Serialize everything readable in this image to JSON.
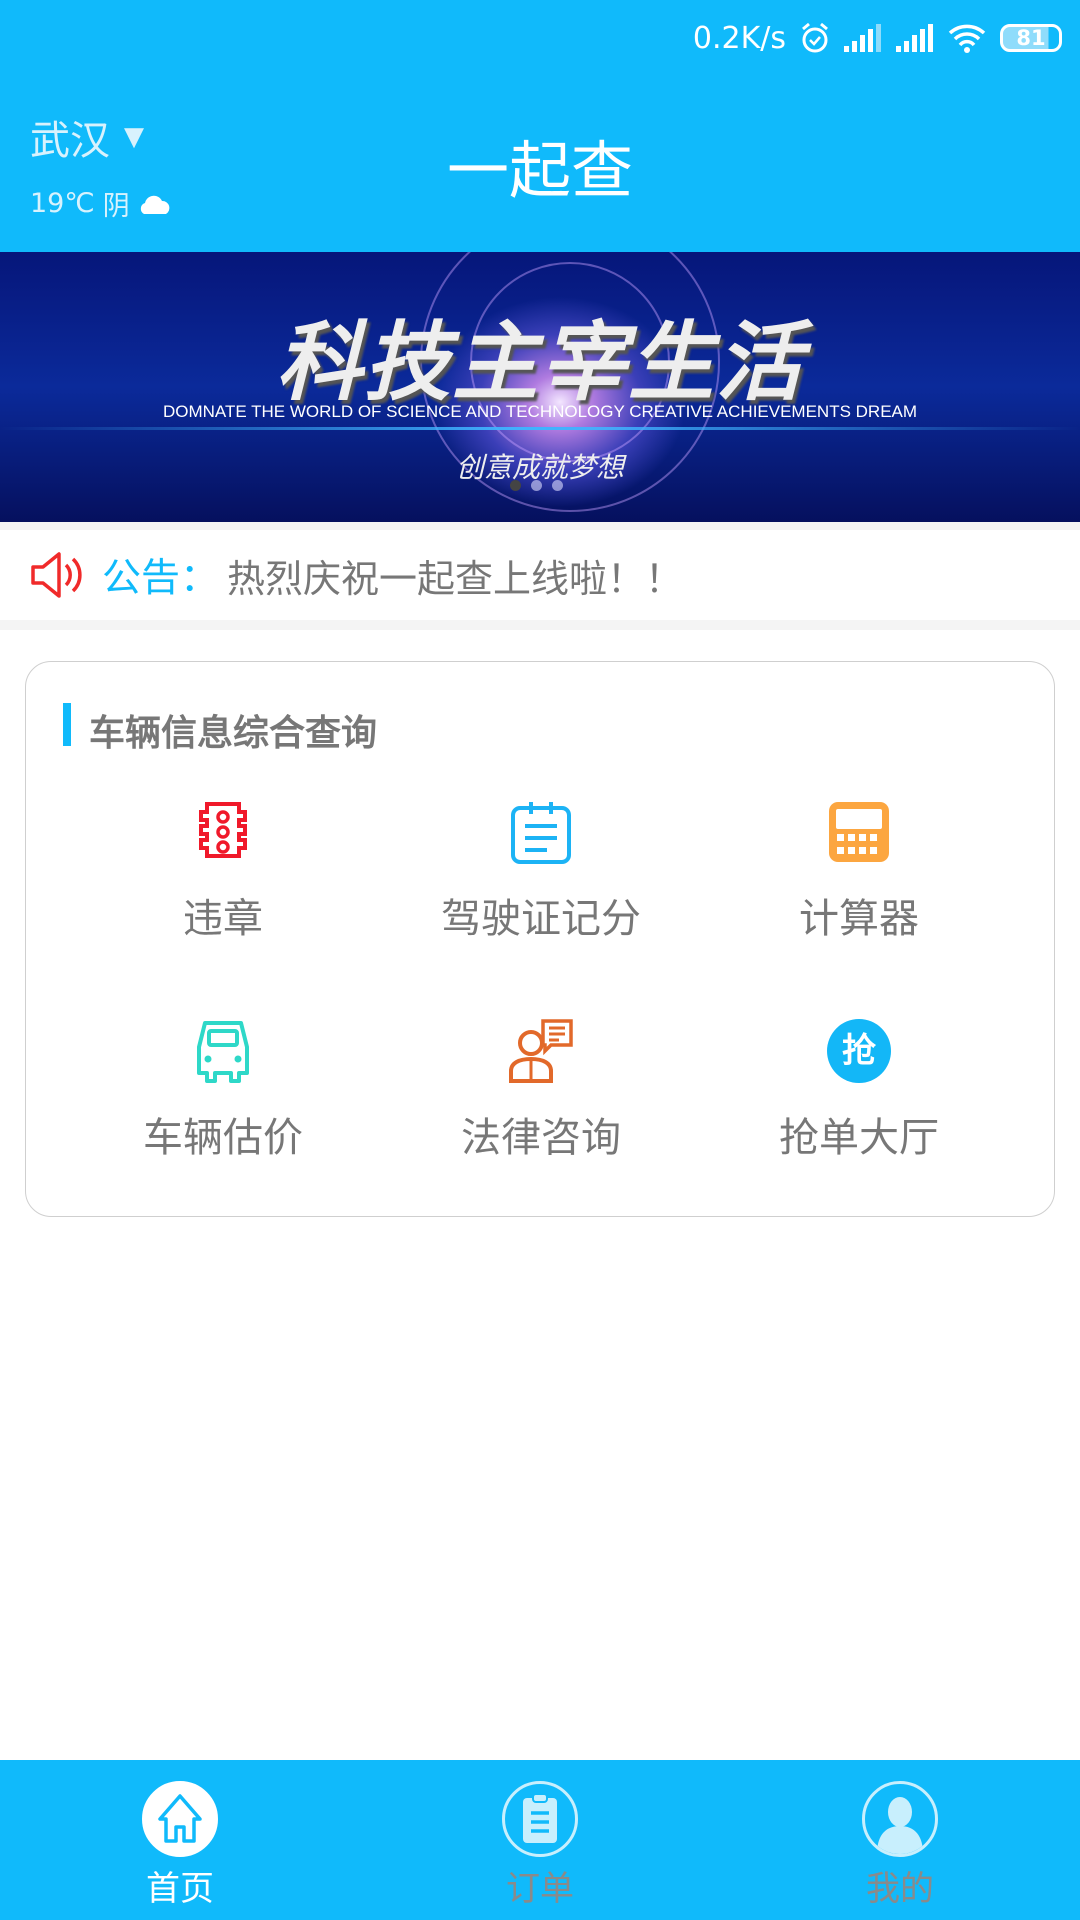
{
  "status_bar": {
    "net_speed": "0.2K/s",
    "battery": "81",
    "icons": [
      "alarm-icon",
      "signal-icon",
      "signal-icon",
      "wifi-icon",
      "battery-icon"
    ]
  },
  "header": {
    "city": "武汉",
    "temperature": "19℃",
    "weather": "阴",
    "title": "一起查",
    "weather_icon": "cloud-icon"
  },
  "banner": {
    "headline": "科技主宰生活",
    "english": "DOMNATE THE WORLD OF SCIENCE AND TECHNOLOGY CREATIVE ACHIEVEMENTS DREAM",
    "subline": "创意成就梦想",
    "slides": 3,
    "active_slide": 1
  },
  "notice": {
    "label": "公告：",
    "text": "热烈庆祝一起查上线啦！！"
  },
  "section": {
    "title": "车辆信息综合查询",
    "items": [
      {
        "label": "违章",
        "icon": "traffic-light-icon",
        "color": "#f0192a"
      },
      {
        "label": "驾驶证记分",
        "icon": "notepad-icon",
        "color": "#1cb3f5"
      },
      {
        "label": "计算器",
        "icon": "calculator-icon",
        "color": "#fca640"
      },
      {
        "label": "车辆估价",
        "icon": "car-icon",
        "color": "#2ed8c8"
      },
      {
        "label": "法律咨询",
        "icon": "consultant-icon",
        "color": "#e2692a"
      },
      {
        "label": "抢单大厅",
        "icon": "grab-order-icon",
        "color": "#13b7f7",
        "glyph": "抢"
      }
    ]
  },
  "bottom_nav": {
    "active": 0,
    "items": [
      {
        "label": "首页",
        "icon": "home-icon"
      },
      {
        "label": "订单",
        "icon": "clipboard-icon"
      },
      {
        "label": "我的",
        "icon": "user-icon"
      }
    ]
  },
  "colors": {
    "primary": "#10bafb",
    "text_gray": "#777777",
    "notice_red": "#f02a2a"
  }
}
